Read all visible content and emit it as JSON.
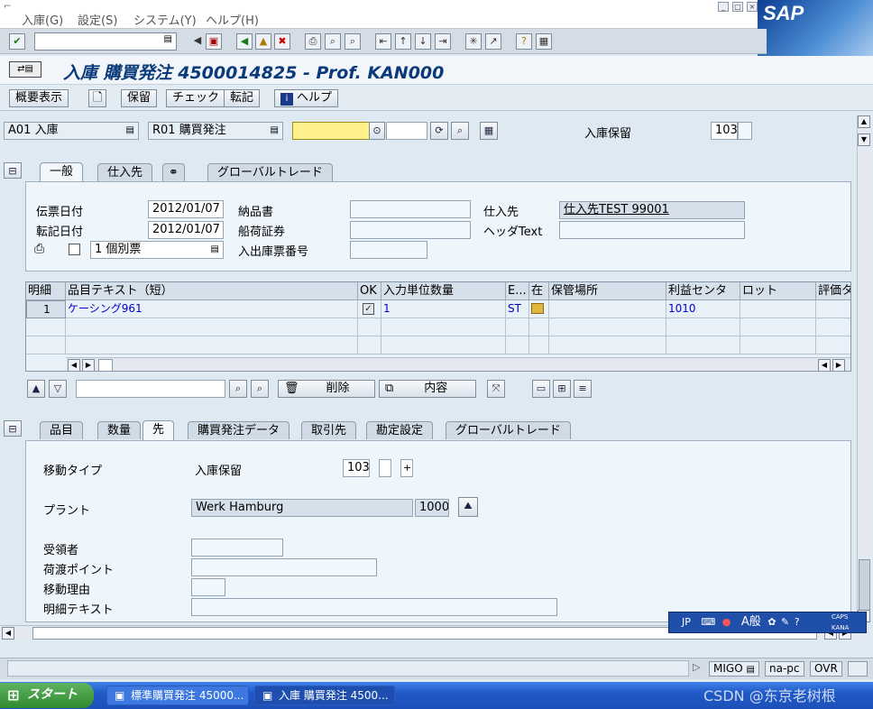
{
  "menu": [
    "入庫(G)",
    "設定(S)",
    "システム(Y)",
    "ヘルプ(H)"
  ],
  "sap_logo": "SAP",
  "title": "入庫 購買発注 4500014825 - Prof. KAN000",
  "app_toolbar": {
    "overview": "概要表示",
    "hold": "保留",
    "check": "チェック",
    "post": "転記",
    "help": "ヘルプ"
  },
  "header": {
    "action": "A01 入庫",
    "ref_doc": "R01 購買発注",
    "movement_label": "入庫保留",
    "movement_type": "103"
  },
  "header_tabs": [
    "一般",
    "仕入先",
    "グローバルトレード"
  ],
  "general": {
    "doc_date_label": "伝票日付",
    "doc_date": "2012/01/07",
    "post_date_label": "転記日付",
    "post_date": "2012/01/07",
    "delivery_note_label": "納品書",
    "bill_of_lading_label": "船荷証券",
    "gr_slip_label": "入出庫票番号",
    "vendor_label": "仕入先",
    "vendor": "仕入先TEST 99001",
    "header_text_label": "ヘッダText",
    "slip_option": "1 個別票"
  },
  "grid": {
    "columns": [
      "明細",
      "品目テキスト（短）",
      "OK",
      "入力単位数量",
      "E...",
      "在",
      "保管場所",
      "利益センタ",
      "ロット",
      "評価タ"
    ],
    "rows": [
      {
        "item": "1",
        "text": "ケーシング961",
        "qty": "1",
        "unit": "ST",
        "profit_center": "1010"
      }
    ]
  },
  "grid_toolbar": {
    "delete": "削除",
    "content": "内容"
  },
  "item_tabs": [
    "品目",
    "数量",
    "先",
    "購買発注データ",
    "取引先",
    "勘定設定",
    "グローバルトレード"
  ],
  "item_detail": {
    "movement_type_label": "移動タイプ",
    "movement_type_text": "入庫保留",
    "movement_type": "103",
    "plus": "+",
    "plant_label": "プラント",
    "plant_name": "Werk Hamburg",
    "plant": "1000",
    "recipient_label": "受領者",
    "unloading_label": "荷渡ポイント",
    "reason_label": "移動理由",
    "item_text_label": "明細テキスト"
  },
  "status": {
    "transaction": "MIGO",
    "client": "na-pc",
    "mode": "OVR"
  },
  "taskbar": {
    "start": "スタート",
    "task1": "標準購買発注 45000...",
    "task2": "入庫 購買発注 4500..."
  },
  "langbar": {
    "jp": "JP",
    "general": "A般",
    "caps": "CAPS",
    "kana": "KANA"
  },
  "watermark": "CSDN @东京老树根"
}
